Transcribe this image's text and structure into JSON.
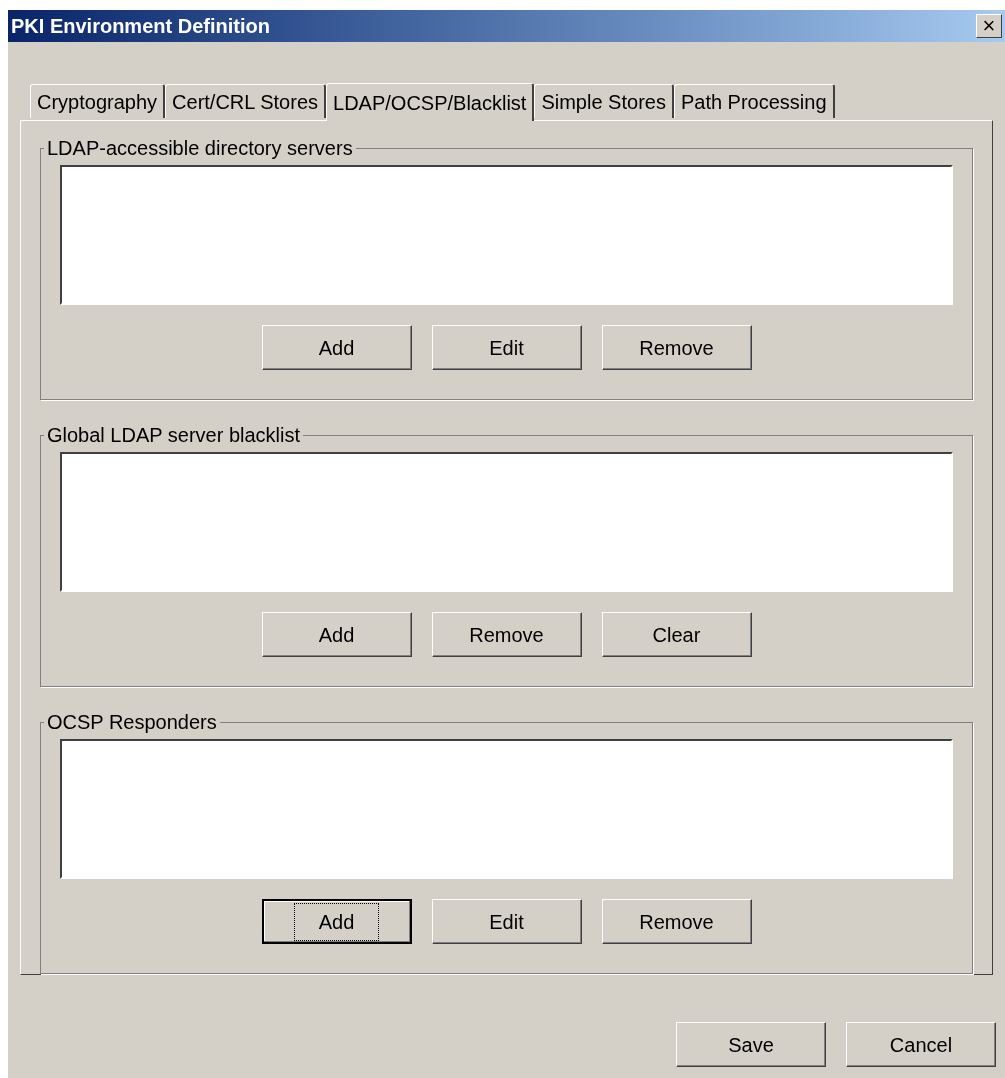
{
  "window": {
    "title": "PKI Environment Definition",
    "close": "×"
  },
  "tabs": [
    {
      "label": "Cryptography",
      "selected": false
    },
    {
      "label": "Cert/CRL Stores",
      "selected": false
    },
    {
      "label": "LDAP/OCSP/Blacklist",
      "selected": true
    },
    {
      "label": "Simple Stores",
      "selected": false
    },
    {
      "label": "Path Processing",
      "selected": false
    }
  ],
  "groups": [
    {
      "title": "LDAP-accessible directory servers",
      "buttons": [
        {
          "label": "Add",
          "focused": false
        },
        {
          "label": "Edit",
          "focused": false
        },
        {
          "label": "Remove",
          "focused": false
        }
      ]
    },
    {
      "title": "Global LDAP server blacklist",
      "buttons": [
        {
          "label": "Add",
          "focused": false
        },
        {
          "label": "Remove",
          "focused": false
        },
        {
          "label": "Clear",
          "focused": false
        }
      ]
    },
    {
      "title": "OCSP Responders",
      "buttons": [
        {
          "label": "Add",
          "focused": true
        },
        {
          "label": "Edit",
          "focused": false
        },
        {
          "label": "Remove",
          "focused": false
        }
      ]
    }
  ],
  "footer_buttons": [
    {
      "label": "Save",
      "focused": false
    },
    {
      "label": "Cancel",
      "focused": false
    }
  ]
}
